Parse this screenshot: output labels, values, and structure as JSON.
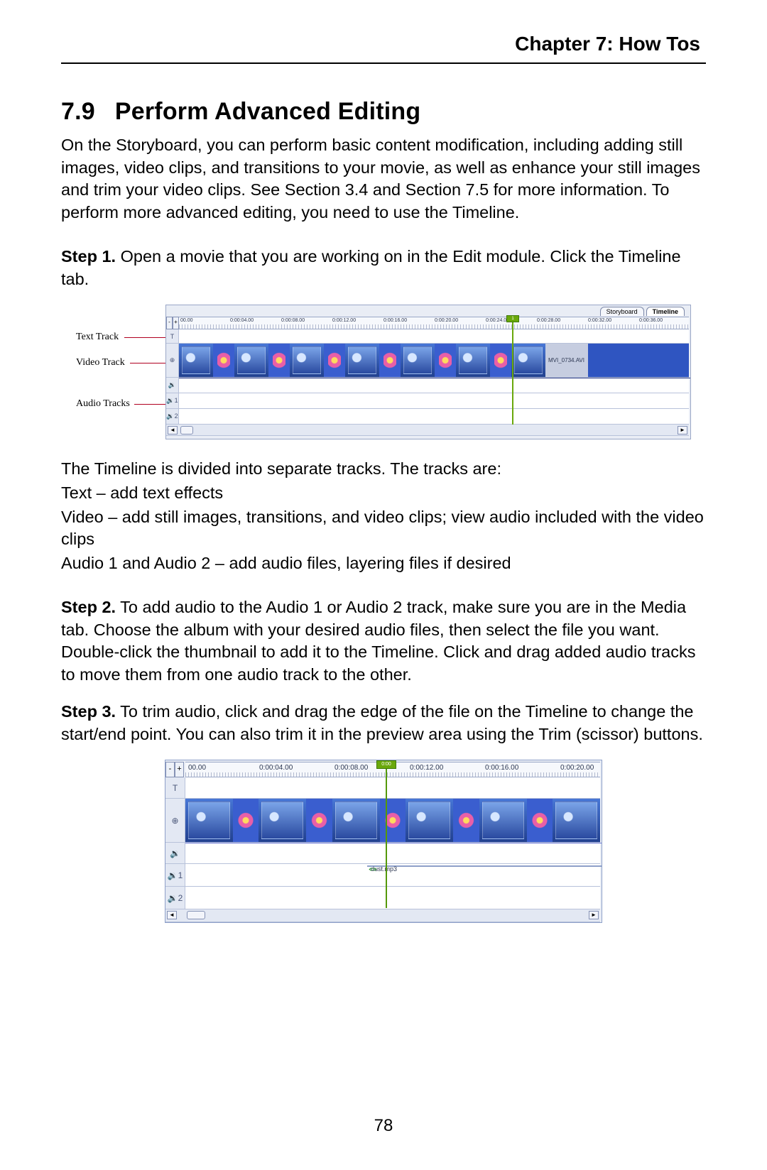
{
  "chapter_header": "Chapter 7:  How Tos",
  "section": {
    "number": "7.9",
    "title": "Perform Advanced Editing"
  },
  "intro": "On the Storyboard, you can perform basic content modification, including adding still images, video clips, and transitions to your movie, as well as enhance your still images and trim your video clips. See Section 3.4 and Section 7.5 for more information. To perform more advanced editing, you need to use the Timeline.",
  "step1": {
    "label": "Step 1.",
    "text": " Open a movie that you are working on in the Edit module. Click the Timeline tab."
  },
  "tracks_intro": "The Timeline is divided into separate tracks. The tracks are:",
  "tracks_text_line": "Text – add text effects",
  "tracks_video_line": "Video – add still images, transitions, and video clips; view audio included with the video clips",
  "tracks_audio_line": "Audio 1 and Audio 2 – add audio files, layering files if desired",
  "step2": {
    "label": "Step 2.",
    "text": " To add audio to the Audio 1 or Audio 2 track, make sure you are in the Media tab. Choose the album with your desired audio files, then select the file you want. Double-click the thumbnail to add it to the Timeline. Click and drag added audio tracks to move them from one audio track to the other."
  },
  "step3": {
    "label": "Step 3.",
    "text": " To trim audio, click and drag the edge of the file on the Timeline to change the start/end point. You can also trim it in the preview area using the Trim (scissor) buttons."
  },
  "page_number": "78",
  "fig1": {
    "callouts": {
      "text": "Text Track",
      "video": "Video Track",
      "audio": "Audio Tracks"
    },
    "zoom_out": "-",
    "zoom_in": "+",
    "tabs": {
      "storyboard": "Storyboard",
      "timeline": "Timeline"
    },
    "ticks": [
      "00.00",
      "0:00:04.00",
      "0:00:08.00",
      "0:00:12.00",
      "0:00:16.00",
      "0:00:20.00",
      "0:00:24.00",
      "0:00:28.00",
      "0:00:32.00",
      "0:00:36.00"
    ],
    "playhead_time": "1",
    "tail_clip_label": "MVI_0734.AVI",
    "icons": {
      "text": "T",
      "video": "⊕",
      "vaudio": "🔉",
      "a1": "🔉1",
      "a2": "🔉2"
    }
  },
  "fig2": {
    "zoom_out": "-",
    "zoom_in": "+",
    "ticks": [
      "00.00",
      "0:00:04.00",
      "0:00:08.00",
      "0:00:12.00",
      "0:00:16.00",
      "0:00:20.00"
    ],
    "playhead_time": "0:00",
    "audio_clip_label": "dust.mp3",
    "drag_hint": "⇔",
    "icons": {
      "text": "T",
      "video": "⊕",
      "vaudio": "🔉",
      "a1": "🔉1",
      "a2": "🔉2"
    }
  }
}
